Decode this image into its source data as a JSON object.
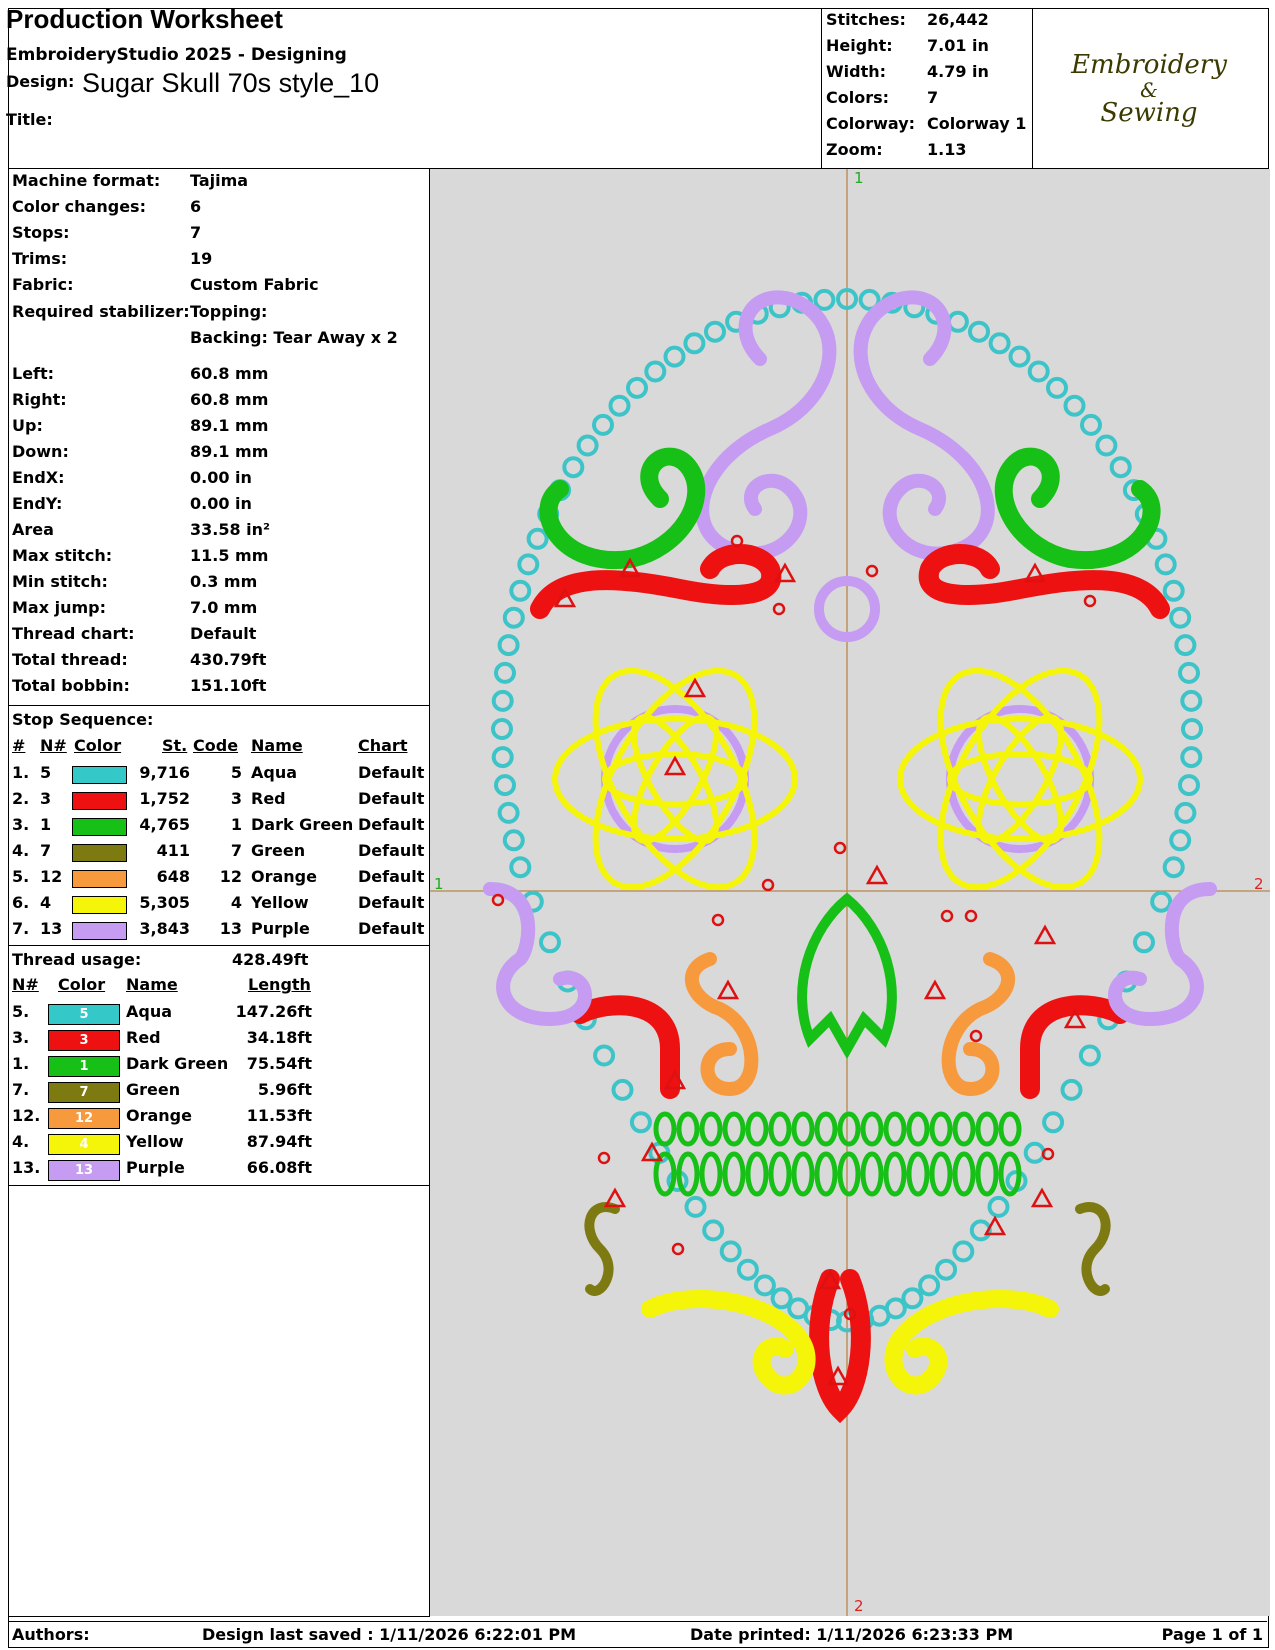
{
  "header": {
    "title": "Production Worksheet",
    "software": "EmbroideryStudio 2025 - Designing",
    "design_label": "Design:",
    "design_name": "Sugar Skull 70s style_10",
    "title_label": "Title:",
    "title_value": ""
  },
  "summary": [
    {
      "label": "Stitches:",
      "value": "26,442"
    },
    {
      "label": "Height:",
      "value": "7.01 in"
    },
    {
      "label": "Width:",
      "value": "4.79 in"
    },
    {
      "label": "Colors:",
      "value": "7"
    },
    {
      "label": "Colorway:",
      "value": "Colorway 1"
    },
    {
      "label": "Zoom:",
      "value": "1.13"
    }
  ],
  "logo": {
    "line1": "Embroidery",
    "line2": "&",
    "line3": "Sewing"
  },
  "specs": [
    {
      "label": "Machine format:",
      "value": "Tajima"
    },
    {
      "label": "Color changes:",
      "value": "6"
    },
    {
      "label": "Stops:",
      "value": "7"
    },
    {
      "label": "Trims:",
      "value": "19"
    },
    {
      "label": "Fabric:",
      "value": "Custom Fabric"
    },
    {
      "label": "Required stabilizer:",
      "value": "Topping:"
    },
    {
      "label": "",
      "value": "Backing: Tear Away x 2"
    },
    {
      "label": "Left:",
      "value": "60.8 mm"
    },
    {
      "label": "Right:",
      "value": "60.8 mm"
    },
    {
      "label": "Up:",
      "value": "89.1 mm"
    },
    {
      "label": "Down:",
      "value": "89.1 mm"
    },
    {
      "label": "EndX:",
      "value": "0.00 in"
    },
    {
      "label": "EndY:",
      "value": "0.00 in"
    },
    {
      "label": "Area",
      "value": "33.58 in²"
    },
    {
      "label": "Max stitch:",
      "value": "11.5 mm"
    },
    {
      "label": "Min stitch:",
      "value": "0.3 mm"
    },
    {
      "label": "Max jump:",
      "value": "7.0 mm"
    },
    {
      "label": "Thread chart:",
      "value": "Default"
    },
    {
      "label": "Total thread:",
      "value": "430.79ft"
    },
    {
      "label": "Total bobbin:",
      "value": "151.10ft"
    }
  ],
  "stop_sequence": {
    "title": "Stop Sequence:",
    "headers": {
      "idx": "#",
      "n": "N#",
      "color": "Color",
      "st": "St.",
      "code": "Code",
      "name": "Name",
      "chart": "Chart"
    },
    "rows": [
      {
        "idx": "1.",
        "n": "5",
        "color": "#35c8c8",
        "st": "9,716",
        "code": "5",
        "name": "Aqua",
        "chart": "Default"
      },
      {
        "idx": "2.",
        "n": "3",
        "color": "#ee1111",
        "st": "1,752",
        "code": "3",
        "name": "Red",
        "chart": "Default"
      },
      {
        "idx": "3.",
        "n": "1",
        "color": "#16c016",
        "st": "4,765",
        "code": "1",
        "name": "Dark Green",
        "chart": "Default"
      },
      {
        "idx": "4.",
        "n": "7",
        "color": "#7e7a12",
        "st": "411",
        "code": "7",
        "name": "Green",
        "chart": "Default"
      },
      {
        "idx": "5.",
        "n": "12",
        "color": "#f79a3e",
        "st": "648",
        "code": "12",
        "name": "Orange",
        "chart": "Default"
      },
      {
        "idx": "6.",
        "n": "4",
        "color": "#f5f50a",
        "st": "5,305",
        "code": "4",
        "name": "Yellow",
        "chart": "Default"
      },
      {
        "idx": "7.",
        "n": "13",
        "color": "#c59cf2",
        "st": "3,843",
        "code": "13",
        "name": "Purple",
        "chart": "Default"
      }
    ]
  },
  "thread_usage": {
    "title": "Thread usage:",
    "total": "428.49ft",
    "headers": {
      "n": "N#",
      "color": "Color",
      "name": "Name",
      "length": "Length"
    },
    "rows": [
      {
        "n": "5.",
        "code": "5",
        "color": "#35c8c8",
        "name": "Aqua",
        "length": "147.26ft"
      },
      {
        "n": "3.",
        "code": "3",
        "color": "#ee1111",
        "name": "Red",
        "length": "34.18ft"
      },
      {
        "n": "1.",
        "code": "1",
        "color": "#16c016",
        "name": "Dark Green",
        "length": "75.54ft"
      },
      {
        "n": "7.",
        "code": "7",
        "color": "#7e7a12",
        "name": "Green",
        "length": "5.96ft"
      },
      {
        "n": "12.",
        "code": "12",
        "color": "#f79a3e",
        "name": "Orange",
        "length": "11.53ft"
      },
      {
        "n": "4.",
        "code": "4",
        "color": "#f5f50a",
        "name": "Yellow",
        "length": "87.94ft"
      },
      {
        "n": "13.",
        "code": "13",
        "color": "#c59cf2",
        "name": "Purple",
        "length": "66.08ft"
      }
    ]
  },
  "axis_labels": {
    "top": "1",
    "left": "1",
    "right": "2",
    "bottom": "2"
  },
  "footer": {
    "authors": "Authors:",
    "saved": "Design last saved : 1/11/2026 6:22:01 PM",
    "printed": "Date printed: 1/11/2026 6:23:33 PM",
    "page": "Page 1 of 1"
  }
}
